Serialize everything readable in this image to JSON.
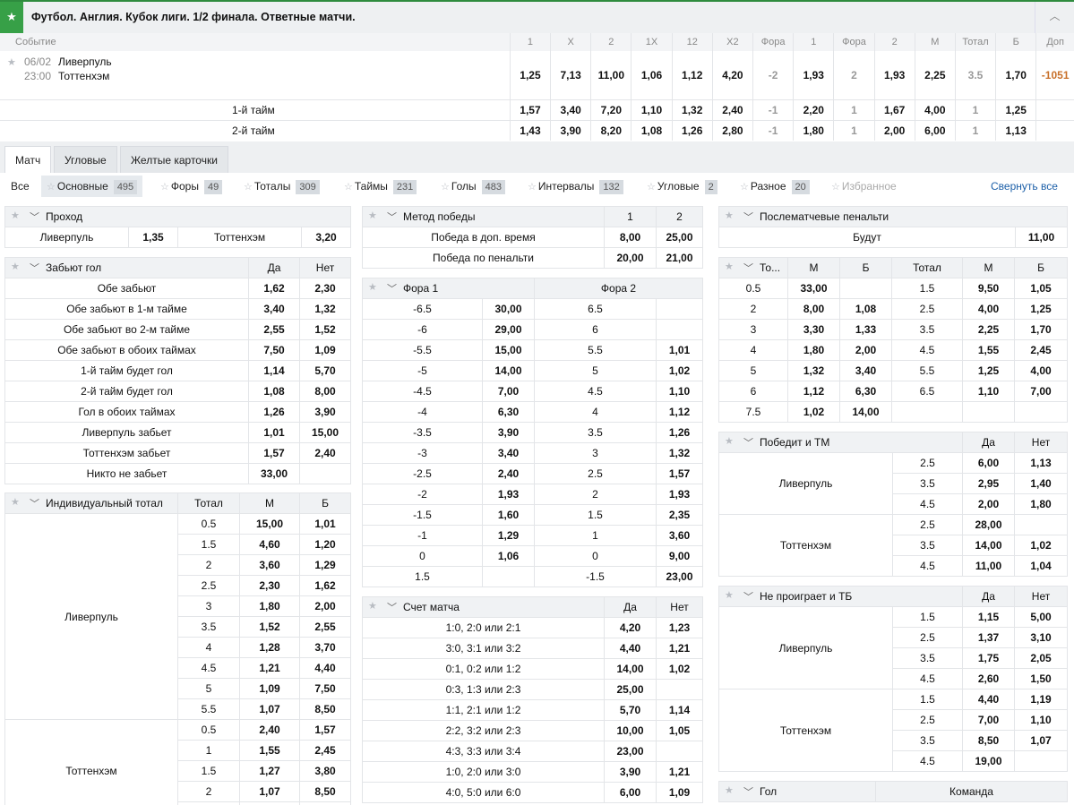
{
  "header": {
    "title": "Футбол. Англия. Кубок лиги. 1/2 финала. Ответные матчи."
  },
  "event": {
    "headers": [
      "Событие",
      "1",
      "X",
      "2",
      "1X",
      "12",
      "X2",
      "Фора",
      "1",
      "Фора",
      "2",
      "М",
      "Тотал",
      "Б",
      "Доп"
    ],
    "date": "06/02",
    "time": "23:00",
    "team1": "Ливерпуль",
    "team2": "Тоттенхэм",
    "main": [
      "1,25",
      "7,13",
      "11,00",
      "1,06",
      "1,12",
      "4,20",
      "-2",
      "1,93",
      "2",
      "1,93",
      "2,25",
      "3.5",
      "1,70",
      "-1051"
    ],
    "halves": [
      {
        "label": "1-й тайм",
        "vals": [
          "1,57",
          "3,40",
          "7,20",
          "1,10",
          "1,32",
          "2,40",
          "-1",
          "2,20",
          "1",
          "1,67",
          "4,00",
          "1",
          "1,25",
          ""
        ]
      },
      {
        "label": "2-й тайм",
        "vals": [
          "1,43",
          "3,90",
          "8,20",
          "1,08",
          "1,26",
          "2,80",
          "-1",
          "1,80",
          "1",
          "2,00",
          "6,00",
          "1",
          "1,13",
          ""
        ]
      }
    ]
  },
  "tabs": [
    "Матч",
    "Угловые",
    "Желтые карточки"
  ],
  "filters": {
    "all": "Все",
    "items": [
      {
        "label": "Основные",
        "count": "495"
      },
      {
        "label": "Форы",
        "count": "49"
      },
      {
        "label": "Тоталы",
        "count": "309"
      },
      {
        "label": "Таймы",
        "count": "231"
      },
      {
        "label": "Голы",
        "count": "483"
      },
      {
        "label": "Интервалы",
        "count": "132"
      },
      {
        "label": "Угловые",
        "count": "2"
      },
      {
        "label": "Разное",
        "count": "20"
      }
    ],
    "favorites": "Избранное",
    "collapse": "Свернуть все"
  },
  "proxod": {
    "title": "Проход",
    "row": [
      "Ливерпуль",
      "1,35",
      "Тоттенхэм",
      "3,20"
    ]
  },
  "zabyut": {
    "title": "Забьют гол",
    "cols": [
      "Да",
      "Нет"
    ],
    "rows": [
      [
        "Обе забьют",
        "1,62",
        "2,30"
      ],
      [
        "Обе забьют в 1-м тайме",
        "3,40",
        "1,32"
      ],
      [
        "Обе забьют во 2-м тайме",
        "2,55",
        "1,52"
      ],
      [
        "Обе забьют в обоих таймах",
        "7,50",
        "1,09"
      ],
      [
        "1-й тайм будет гол",
        "1,14",
        "5,70"
      ],
      [
        "2-й тайм будет гол",
        "1,08",
        "8,00"
      ],
      [
        "Гол в обоих таймах",
        "1,26",
        "3,90"
      ],
      [
        "Ливерпуль забьет",
        "1,01",
        "15,00"
      ],
      [
        "Тоттенхэм забьет",
        "1,57",
        "2,40"
      ],
      [
        "Никто не забьет",
        "33,00",
        ""
      ]
    ]
  },
  "indtotal": {
    "title": "Индивидуальный тотал",
    "cols": [
      "Тотал",
      "М",
      "Б"
    ],
    "team1": "Ливерпуль",
    "rows1": [
      [
        "0.5",
        "15,00",
        "1,01"
      ],
      [
        "1.5",
        "4,60",
        "1,20"
      ],
      [
        "2",
        "3,60",
        "1,29"
      ],
      [
        "2.5",
        "2,30",
        "1,62"
      ],
      [
        "3",
        "1,80",
        "2,00"
      ],
      [
        "3.5",
        "1,52",
        "2,55"
      ],
      [
        "4",
        "1,28",
        "3,70"
      ],
      [
        "4.5",
        "1,21",
        "4,40"
      ],
      [
        "5",
        "1,09",
        "7,50"
      ],
      [
        "5.5",
        "1,07",
        "8,50"
      ]
    ],
    "team2": "Тоттенхэм",
    "rows2": [
      [
        "0.5",
        "2,40",
        "1,57"
      ],
      [
        "1",
        "1,55",
        "2,45"
      ],
      [
        "1.5",
        "1,27",
        "3,80"
      ],
      [
        "2",
        "1,07",
        "8,50"
      ]
    ]
  },
  "metod": {
    "title": "Метод победы",
    "cols": [
      "1",
      "2"
    ],
    "rows": [
      [
        "Победа в доп. время",
        "8,00",
        "25,00"
      ],
      [
        "Победа по пенальти",
        "20,00",
        "21,00"
      ]
    ]
  },
  "fora": {
    "title1": "Фора 1",
    "title2": "Фора 2",
    "rows": [
      [
        "-6.5",
        "30,00",
        "6.5",
        ""
      ],
      [
        "-6",
        "29,00",
        "6",
        ""
      ],
      [
        "-5.5",
        "15,00",
        "5.5",
        "1,01"
      ],
      [
        "-5",
        "14,00",
        "5",
        "1,02"
      ],
      [
        "-4.5",
        "7,00",
        "4.5",
        "1,10"
      ],
      [
        "-4",
        "6,30",
        "4",
        "1,12"
      ],
      [
        "-3.5",
        "3,90",
        "3.5",
        "1,26"
      ],
      [
        "-3",
        "3,40",
        "3",
        "1,32"
      ],
      [
        "-2.5",
        "2,40",
        "2.5",
        "1,57"
      ],
      [
        "-2",
        "1,93",
        "2",
        "1,93"
      ],
      [
        "-1.5",
        "1,60",
        "1.5",
        "2,35"
      ],
      [
        "-1",
        "1,29",
        "1",
        "3,60"
      ],
      [
        "0",
        "1,06",
        "0",
        "9,00"
      ],
      [
        "1.5",
        "",
        "-1.5",
        "23,00"
      ]
    ]
  },
  "schet": {
    "title": "Счет матча",
    "cols": [
      "Да",
      "Нет"
    ],
    "rows": [
      [
        "1:0, 2:0 или 2:1",
        "4,20",
        "1,23"
      ],
      [
        "3:0, 3:1 или 3:2",
        "4,40",
        "1,21"
      ],
      [
        "0:1, 0:2 или 1:2",
        "14,00",
        "1,02"
      ],
      [
        "0:3, 1:3 или 2:3",
        "25,00",
        ""
      ],
      [
        "1:1, 2:1 или 1:2",
        "5,70",
        "1,14"
      ],
      [
        "2:2, 3:2 или 2:3",
        "10,00",
        "1,05"
      ],
      [
        "4:3, 3:3 или 3:4",
        "23,00",
        ""
      ],
      [
        "1:0, 2:0 или 3:0",
        "3,90",
        "1,21"
      ],
      [
        "4:0, 5:0 или 6:0",
        "6,00",
        "1,09"
      ]
    ]
  },
  "penalty": {
    "title": "Послематчевые пенальти",
    "row": [
      "Будут",
      "11,00"
    ]
  },
  "totals": {
    "cols": [
      "То...",
      "М",
      "Б",
      "Тотал",
      "М",
      "Б"
    ],
    "rows": [
      [
        "0.5",
        "33,00",
        "",
        "1.5",
        "9,50",
        "1,05"
      ],
      [
        "2",
        "8,00",
        "1,08",
        "2.5",
        "4,00",
        "1,25"
      ],
      [
        "3",
        "3,30",
        "1,33",
        "3.5",
        "2,25",
        "1,70"
      ],
      [
        "4",
        "1,80",
        "2,00",
        "4.5",
        "1,55",
        "2,45"
      ],
      [
        "5",
        "1,32",
        "3,40",
        "5.5",
        "1,25",
        "4,00"
      ],
      [
        "6",
        "1,12",
        "6,30",
        "6.5",
        "1,10",
        "7,00"
      ],
      [
        "7.5",
        "1,02",
        "14,00",
        "",
        "",
        ""
      ]
    ]
  },
  "pobeditTM": {
    "title": "Победит и ТМ",
    "cols": [
      "Да",
      "Нет"
    ],
    "team1": "Ливерпуль",
    "rows1": [
      [
        "2.5",
        "6,00",
        "1,13"
      ],
      [
        "3.5",
        "2,95",
        "1,40"
      ],
      [
        "4.5",
        "2,00",
        "1,80"
      ]
    ],
    "team2": "Тоттенхэм",
    "rows2": [
      [
        "2.5",
        "28,00",
        ""
      ],
      [
        "3.5",
        "14,00",
        "1,02"
      ],
      [
        "4.5",
        "11,00",
        "1,04"
      ]
    ]
  },
  "neproigraet": {
    "title": "Не проиграет и ТБ",
    "cols": [
      "Да",
      "Нет"
    ],
    "team1": "Ливерпуль",
    "rows1": [
      [
        "1.5",
        "1,15",
        "5,00"
      ],
      [
        "2.5",
        "1,37",
        "3,10"
      ],
      [
        "3.5",
        "1,75",
        "2,05"
      ],
      [
        "4.5",
        "2,60",
        "1,50"
      ]
    ],
    "team2": "Тоттенхэм",
    "rows2": [
      [
        "1.5",
        "4,40",
        "1,19"
      ],
      [
        "2.5",
        "7,00",
        "1,10"
      ],
      [
        "3.5",
        "8,50",
        "1,07"
      ],
      [
        "4.5",
        "19,00",
        ""
      ]
    ]
  },
  "gol": {
    "title": "Гол",
    "col": "Команда"
  }
}
